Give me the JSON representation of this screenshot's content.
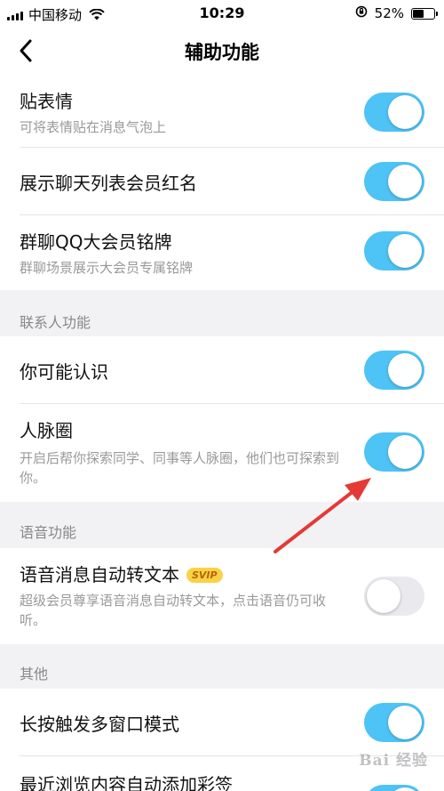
{
  "status_bar": {
    "carrier": "中国移动",
    "time": "10:29",
    "battery_percent": "52%",
    "battery_level": 0.52
  },
  "nav": {
    "title": "辅助功能"
  },
  "rows": {
    "sticker": {
      "title": "贴表情",
      "desc": "可将表情贴在消息气泡上",
      "enabled": true
    },
    "vip_red_name": {
      "title": "展示聊天列表会员红名",
      "enabled": true
    },
    "group_badge": {
      "title": "群聊QQ大会员铭牌",
      "desc": "群聊场景展示大会员专属铭牌",
      "enabled": true
    },
    "may_know": {
      "title": "你可能认识",
      "enabled": true
    },
    "network": {
      "title": "人脉圈",
      "desc": "开启后帮你探索同学、同事等人脉圈，他们也可探索到你。",
      "enabled": true
    },
    "voice_to_text": {
      "title": "语音消息自动转文本",
      "badge": "SVIP",
      "desc": "超级会员尊享语音消息自动转文本，点击语音仍可收听。",
      "enabled": false
    },
    "multi_window": {
      "title": "长按触发多窗口模式",
      "enabled": true
    },
    "auto_tag": {
      "title": "最近浏览内容自动添加彩签",
      "enabled": true
    }
  },
  "sections": {
    "contacts": "联系人功能",
    "voice": "语音功能",
    "other": "其他"
  },
  "watermark": "Bai 经验",
  "colors": {
    "toggle_on": "#4ec3f5",
    "toggle_off": "#e9e9ee",
    "arrow": "#e53935"
  }
}
